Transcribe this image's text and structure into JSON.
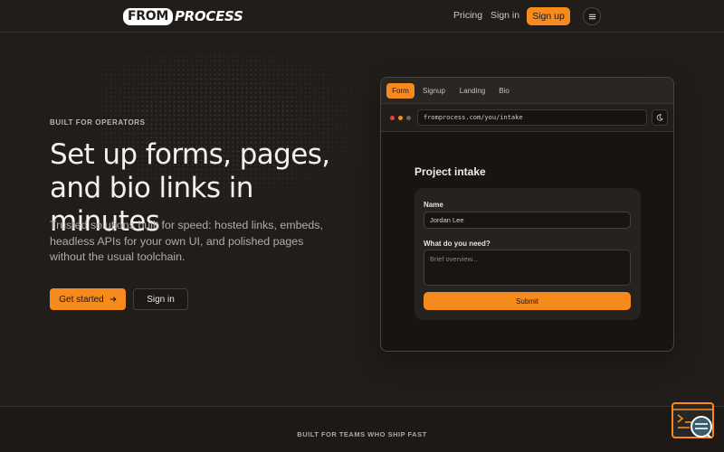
{
  "brand": {
    "logo_left": "FROM",
    "logo_right": "PROCESS"
  },
  "nav": {
    "pricing": "Pricing",
    "sign_in": "Sign in",
    "sign_up": "Sign up"
  },
  "hero": {
    "eyebrow": "BUILT FOR OPERATORS",
    "headline": "Set up forms, pages, and bio links in minutes",
    "lede": "Trusted solutions built for speed: hosted links, embeds, headless APIs for your own UI, and polished pages without the usual toolchain.",
    "cta_primary": "Get started",
    "cta_secondary": "Sign in"
  },
  "preview": {
    "tabs": [
      {
        "label": "Form",
        "active": true
      },
      {
        "label": "Signup",
        "active": false
      },
      {
        "label": "Landing",
        "active": false
      },
      {
        "label": "Bio",
        "active": false
      }
    ],
    "url": "fromprocess.com/you/intake",
    "form_title": "Project intake",
    "fields": {
      "name_label": "Name",
      "name_value": "Jordan Lee",
      "need_label": "What do you need?",
      "need_placeholder": "Brief overview..."
    },
    "submit": "Submit"
  },
  "footer_strip": {
    "label": "BUILT FOR TEAMS WHO SHIP FAST"
  },
  "colors": {
    "accent": "#f78a1d",
    "background": "#211d1b",
    "panel": "#262220"
  },
  "icons": {
    "menu": "hamburger-icon",
    "arrow": "arrow-right-icon",
    "theme": "moon-icon",
    "widget": "terminal-chat-icon"
  }
}
